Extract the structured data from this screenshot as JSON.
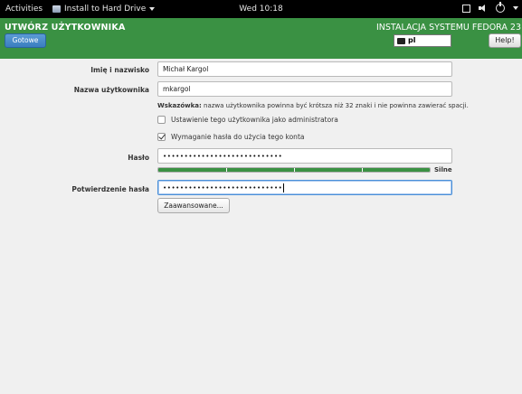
{
  "topbar": {
    "activities": "Activities",
    "app_name": "Install to Hard Drive",
    "clock": "Wed 10:18"
  },
  "header": {
    "title": "UTWÓRZ UŻYTKOWNIKA",
    "done_label": "Gotowe",
    "install_title": "INSTALACJA SYSTEMU FEDORA 23",
    "keyboard_layout": "pl",
    "help_label": "Help!",
    "accent_color": "#3a9143",
    "button_color": "#3a7ec0"
  },
  "form": {
    "full_name_label": "Imię i nazwisko",
    "full_name_value": "Michał Kargol",
    "username_label": "Nazwa użytkownika",
    "username_value": "mkargol",
    "hint_prefix": "Wskazówka:",
    "hint_text": "nazwa użytkownika powinna być krótsza niż 32 znaki i nie powinna zawierać spacji.",
    "admin_checkbox_label": "Ustawienie tego użytkownika jako administratora",
    "admin_checked": false,
    "require_password_label": "Wymaganie hasła do użycia tego konta",
    "require_password_checked": true,
    "password_label": "Hasło",
    "password_value": "••••••••••••••••••••••••••••",
    "strength_label": "Silne",
    "strength_level": 1.0,
    "confirm_label": "Potwierdzenie hasła",
    "confirm_value": "••••••••••••••••••••••••••••",
    "advanced_label": "Zaawansowane..."
  },
  "icons": {
    "app": "drive-icon",
    "keyboard": "keyboard-icon",
    "window": "window-icon",
    "volume": "volume-icon",
    "power": "power-icon"
  }
}
